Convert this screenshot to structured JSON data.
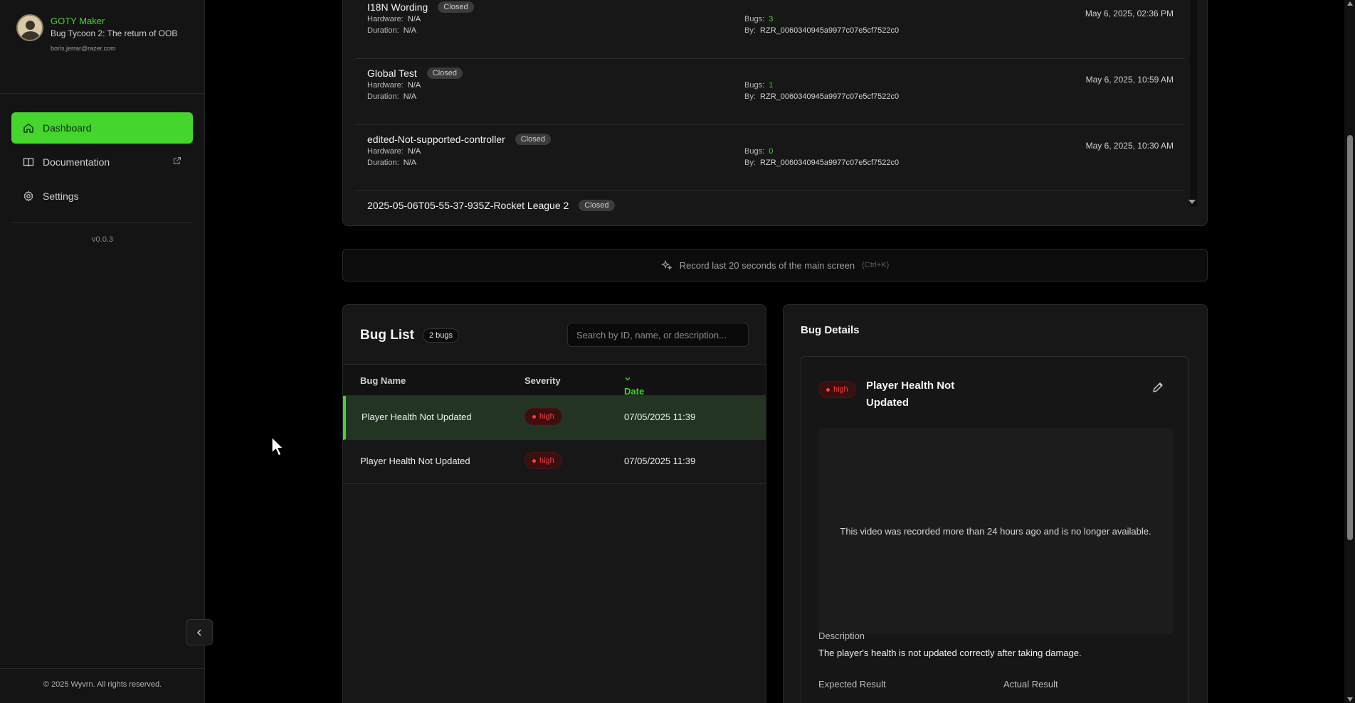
{
  "profile": {
    "name": "GOTY Maker",
    "game": "Bug Tycoon 2: The return of OOB",
    "email": "boris.jerrar@razer.com"
  },
  "nav": {
    "items": [
      {
        "label": "Dashboard",
        "icon": "home-icon",
        "active": true
      },
      {
        "label": "Documentation",
        "icon": "book-icon",
        "external": true
      },
      {
        "label": "Settings",
        "icon": "gear-icon"
      }
    ],
    "version": "v0.0.3"
  },
  "footer": {
    "copyright": "© 2025 Wyvrn. All rights reserved."
  },
  "sessions": {
    "hardware_label": "Hardware:",
    "duration_label": "Duration:",
    "bugs_label": "Bugs:",
    "by_label": "By:",
    "items": [
      {
        "title": "I18N Wording",
        "status": "Closed",
        "hardware": "N/A",
        "duration": "N/A",
        "bugs": "3",
        "by": "RZR_0060340945a9977c07e5cf7522c0",
        "date": "May 6, 2025, 02:36 PM"
      },
      {
        "title": "Global Test",
        "status": "Closed",
        "hardware": "N/A",
        "duration": "N/A",
        "bugs": "1",
        "by": "RZR_0060340945a9977c07e5cf7522c0",
        "date": "May 6, 2025, 10:59 AM"
      },
      {
        "title": "edited-Not-supported-controller",
        "status": "Closed",
        "hardware": "N/A",
        "duration": "N/A",
        "bugs": "0",
        "by": "RZR_0060340945a9977c07e5cf7522c0",
        "date": "May 6, 2025, 10:30 AM"
      },
      {
        "title": "2025-05-06T05-55-37-935Z-Rocket League 2",
        "status": "Closed"
      }
    ]
  },
  "record": {
    "label": "Record last 20 seconds of the main screen",
    "shortcut": "(Ctrl+K)"
  },
  "buglist": {
    "title": "Bug List",
    "count": "2 bugs",
    "search_placeholder": "Search by ID, name, or description...",
    "columns": {
      "name": "Bug Name",
      "severity": "Severity",
      "date": "Date"
    },
    "rows": [
      {
        "name": "Player Health Not Updated",
        "severity": "high",
        "date": "07/05/2025 11:39",
        "selected": true
      },
      {
        "name": "Player Health Not Updated",
        "severity": "high",
        "date": "07/05/2025 11:39"
      }
    ]
  },
  "details": {
    "title": "Bug Details",
    "severity": "high",
    "bug_name": "Player Health Not Updated",
    "video_message": "This video was recorded more than 24 hours ago and is no longer available.",
    "description_label": "Description",
    "description": "The player's health is not updated correctly after taking damage.",
    "expected_label": "Expected Result",
    "actual_label": "Actual Result"
  },
  "colors": {
    "accent": "#44d62c",
    "severity_high": "#ff3b3b",
    "background": "#000000"
  }
}
